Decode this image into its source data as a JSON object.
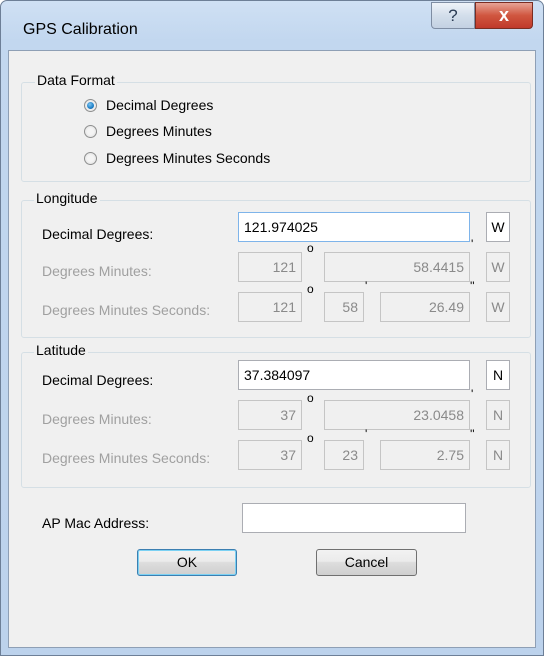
{
  "window": {
    "title": "GPS Calibration",
    "help_label": "?",
    "close_label": "x"
  },
  "data_format": {
    "legend": "Data Format",
    "options": [
      {
        "label": "Decimal Degrees",
        "checked": true
      },
      {
        "label": "Degrees Minutes",
        "checked": false
      },
      {
        "label": "Degrees Minutes Seconds",
        "checked": false
      }
    ]
  },
  "longitude": {
    "legend": "Longitude",
    "dd_label": "Decimal Degrees:",
    "dd_value": "121.974025",
    "dd_dir": "W",
    "dm_label": "Degrees Minutes:",
    "dm_deg": "121",
    "dm_min": "58.4415",
    "dm_dir": "W",
    "dms_label": "Degrees Minutes Seconds:",
    "dms_deg": "121",
    "dms_min": "58",
    "dms_sec": "26.49",
    "dms_dir": "W"
  },
  "latitude": {
    "legend": "Latitude",
    "dd_label": "Decimal Degrees:",
    "dd_value": "37.384097",
    "dd_dir": "N",
    "dm_label": "Degrees Minutes:",
    "dm_deg": "37",
    "dm_min": "23.0458",
    "dm_dir": "N",
    "dms_label": "Degrees Minutes Seconds:",
    "dms_deg": "37",
    "dms_min": "23",
    "dms_sec": "2.75",
    "dms_dir": "N"
  },
  "symbols": {
    "degree": "o",
    "minute": "'",
    "second": "''"
  },
  "ap_mac": {
    "label": "AP Mac Address:",
    "value": ""
  },
  "buttons": {
    "ok": "OK",
    "cancel": "Cancel"
  }
}
